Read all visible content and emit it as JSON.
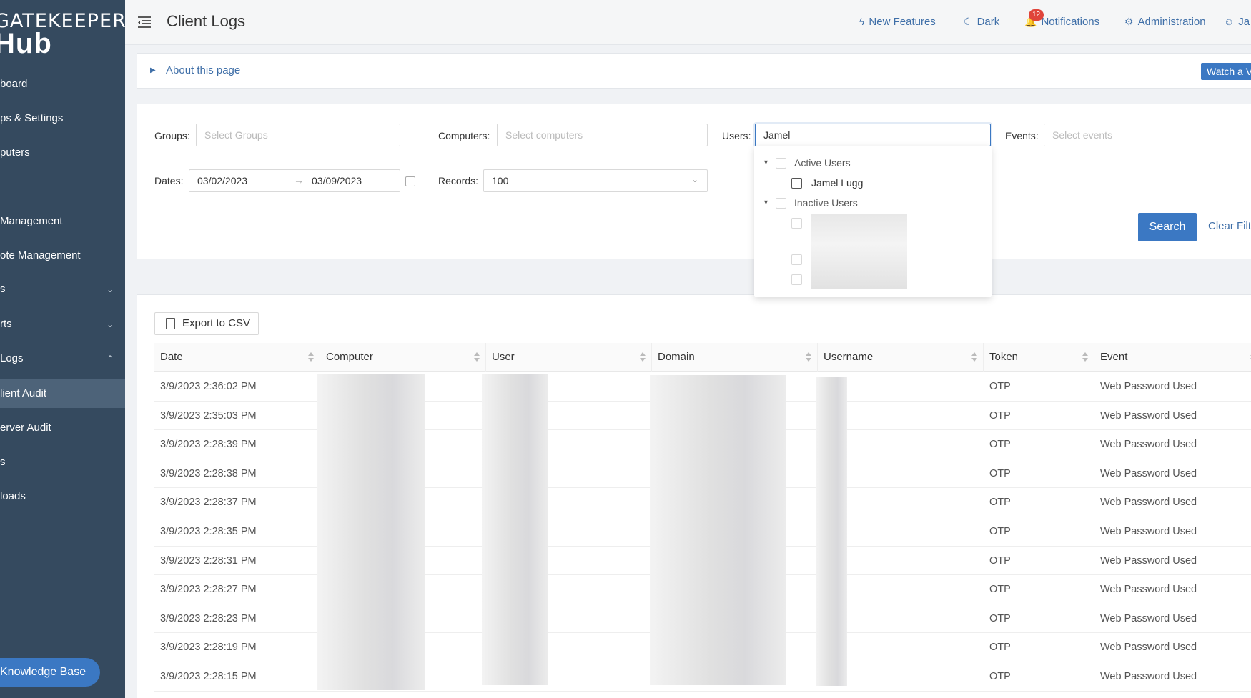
{
  "sidebar": {
    "brand_top": "GATEKEEPER",
    "brand_bottom": "Hub",
    "items": [
      {
        "label": "Dashboard",
        "visible": "board"
      },
      {
        "label": "Groups & Settings",
        "visible": "ps & Settings"
      },
      {
        "label": "Computers",
        "visible": "puters"
      },
      {
        "label": "User Management",
        "visible": "Management"
      },
      {
        "label": "Remote Management",
        "visible": "ote Management"
      },
      {
        "label": "s",
        "visible": "s"
      },
      {
        "label": "Reports",
        "visible": "rts"
      },
      {
        "label": "Logs",
        "visible": "Logs"
      },
      {
        "label": "Client Audit",
        "visible": "lient Audit"
      },
      {
        "label": "Server Audit",
        "visible": "erver Audit"
      },
      {
        "label": "s",
        "visible": "s"
      },
      {
        "label": "Downloads",
        "visible": "loads"
      }
    ],
    "knowledge_base": "Knowledge Base"
  },
  "header": {
    "title": "Client Logs",
    "new_features": "New Features",
    "dark": "Dark",
    "notifications": "Notifications",
    "notification_count": "12",
    "administration": "Administration",
    "user": "Ja"
  },
  "about": {
    "label": "About this page",
    "watch_button": "Watch a V"
  },
  "filters": {
    "groups_label": "Groups",
    "groups_placeholder": "Select Groups",
    "computers_label": "Computers",
    "computers_placeholder": "Select computers",
    "users_label": "Users",
    "users_value": "Jamel",
    "events_label": "Events",
    "events_placeholder": "Select events",
    "dates_label": "Dates",
    "date_from": "03/02/2023",
    "date_to": "03/09/2023",
    "records_label": "Records",
    "records_value": "100",
    "search_button": "Search",
    "clear_button": "Clear Filte"
  },
  "user_dropdown": {
    "active_group": "Active Users",
    "active_user": "Jamel Lugg",
    "inactive_group": "Inactive Users"
  },
  "table": {
    "export_button": "Export to CSV",
    "columns": [
      "Date",
      "Computer",
      "User",
      "Domain",
      "Username",
      "Token",
      "Event"
    ],
    "rows": [
      {
        "date": "3/9/2023 2:36:02 PM",
        "token": "OTP",
        "event": "Web Password Used"
      },
      {
        "date": "3/9/2023 2:35:03 PM",
        "token": "OTP",
        "event": "Web Password Used"
      },
      {
        "date": "3/9/2023 2:28:39 PM",
        "token": "OTP",
        "event": "Web Password Used"
      },
      {
        "date": "3/9/2023 2:28:38 PM",
        "token": "OTP",
        "event": "Web Password Used"
      },
      {
        "date": "3/9/2023 2:28:37 PM",
        "token": "OTP",
        "event": "Web Password Used"
      },
      {
        "date": "3/9/2023 2:28:35 PM",
        "token": "OTP",
        "event": "Web Password Used"
      },
      {
        "date": "3/9/2023 2:28:31 PM",
        "token": "OTP",
        "event": "Web Password Used"
      },
      {
        "date": "3/9/2023 2:28:27 PM",
        "token": "OTP",
        "event": "Web Password Used"
      },
      {
        "date": "3/9/2023 2:28:23 PM",
        "token": "OTP",
        "event": "Web Password Used"
      },
      {
        "date": "3/9/2023 2:28:19 PM",
        "token": "OTP",
        "event": "Web Password Used"
      },
      {
        "date": "3/9/2023 2:28:15 PM",
        "token": "OTP",
        "event": "Web Password Used"
      }
    ]
  },
  "colors": {
    "sidebar_bg": "#354a5f",
    "accent": "#3b78c3",
    "link": "#3f6fa8",
    "badge": "#e0453b"
  }
}
